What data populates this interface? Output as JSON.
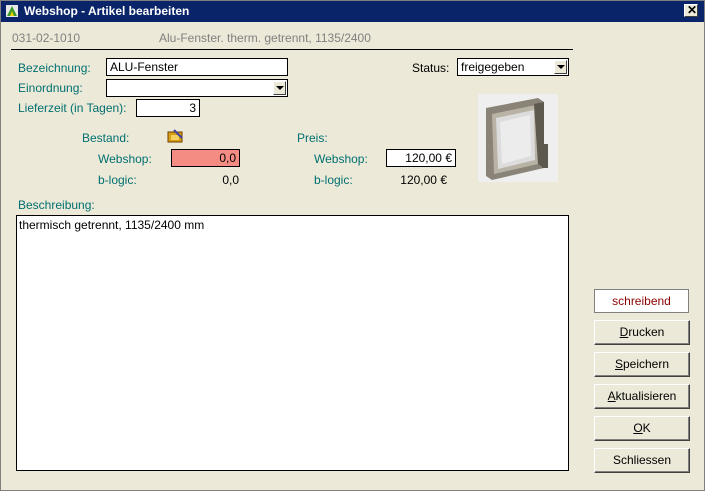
{
  "window": {
    "title": "Webshop - Artikel bearbeiten"
  },
  "header": {
    "article_number": "031-02-1010",
    "article_description": "Alu-Fenster. therm. getrennt, 1135/2400"
  },
  "form": {
    "bezeichnung_label": "Bezeichnung:",
    "bezeichnung_value": "ALU-Fenster",
    "einordnung_label": "Einordnung:",
    "einordnung_value": "",
    "lieferzeit_label": "Lieferzeit (in Tagen):",
    "lieferzeit_value": "3",
    "status_label": "Status:",
    "status_value": "freigegeben"
  },
  "bestand": {
    "heading": "Bestand:",
    "webshop_label": "Webshop:",
    "webshop_value": "0,0",
    "blogic_label": "b-logic:",
    "blogic_value": "0,0"
  },
  "preis": {
    "heading": "Preis:",
    "webshop_label": "Webshop:",
    "webshop_value": "120,00 €",
    "blogic_label": "b-logic:",
    "blogic_value": "120,00 €"
  },
  "beschreibung": {
    "label": "Beschreibung:",
    "text": "thermisch getrennt, 1135/2400 mm"
  },
  "side": {
    "status_text": "schreibend",
    "buttons": [
      {
        "pre": "",
        "key": "D",
        "post": "rucken"
      },
      {
        "pre": "",
        "key": "S",
        "post": "peichern"
      },
      {
        "pre": "",
        "key": "A",
        "post": "ktualisieren"
      },
      {
        "pre": "",
        "key": "O",
        "post": "K"
      },
      {
        "pre": "Schliessen",
        "key": "",
        "post": ""
      }
    ]
  },
  "colors": {
    "title_bg": "#0a246a",
    "label": "#007070",
    "stock_warning": "#f48c84",
    "status_text": "#8b0000"
  }
}
